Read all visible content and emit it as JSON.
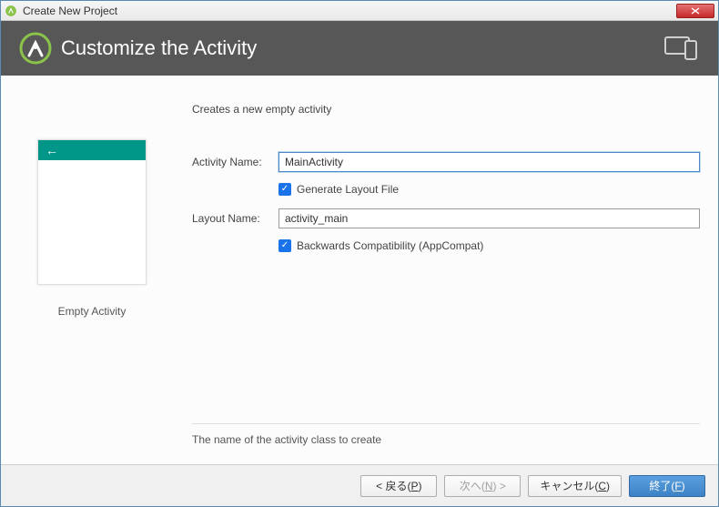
{
  "window": {
    "title": "Create New Project"
  },
  "header": {
    "title": "Customize the Activity"
  },
  "preview": {
    "caption": "Empty Activity"
  },
  "form": {
    "description": "Creates a new empty activity",
    "activity_name_label": "Activity Name:",
    "activity_name_value": "MainActivity",
    "generate_layout_label": "Generate Layout File",
    "layout_name_label": "Layout Name:",
    "layout_name_value": "activity_main",
    "backwards_compat_label": "Backwards Compatibility (AppCompat)",
    "info_text": "The name of the activity class to create"
  },
  "buttons": {
    "back_pre": "< 戻る(",
    "back_mn": "P",
    "back_post": ")",
    "next_pre": "次へ(",
    "next_mn": "N",
    "next_post": ") >",
    "cancel_pre": "キャンセル(",
    "cancel_mn": "C",
    "cancel_post": ")",
    "finish_pre": "終了(",
    "finish_mn": "F",
    "finish_post": ")"
  }
}
